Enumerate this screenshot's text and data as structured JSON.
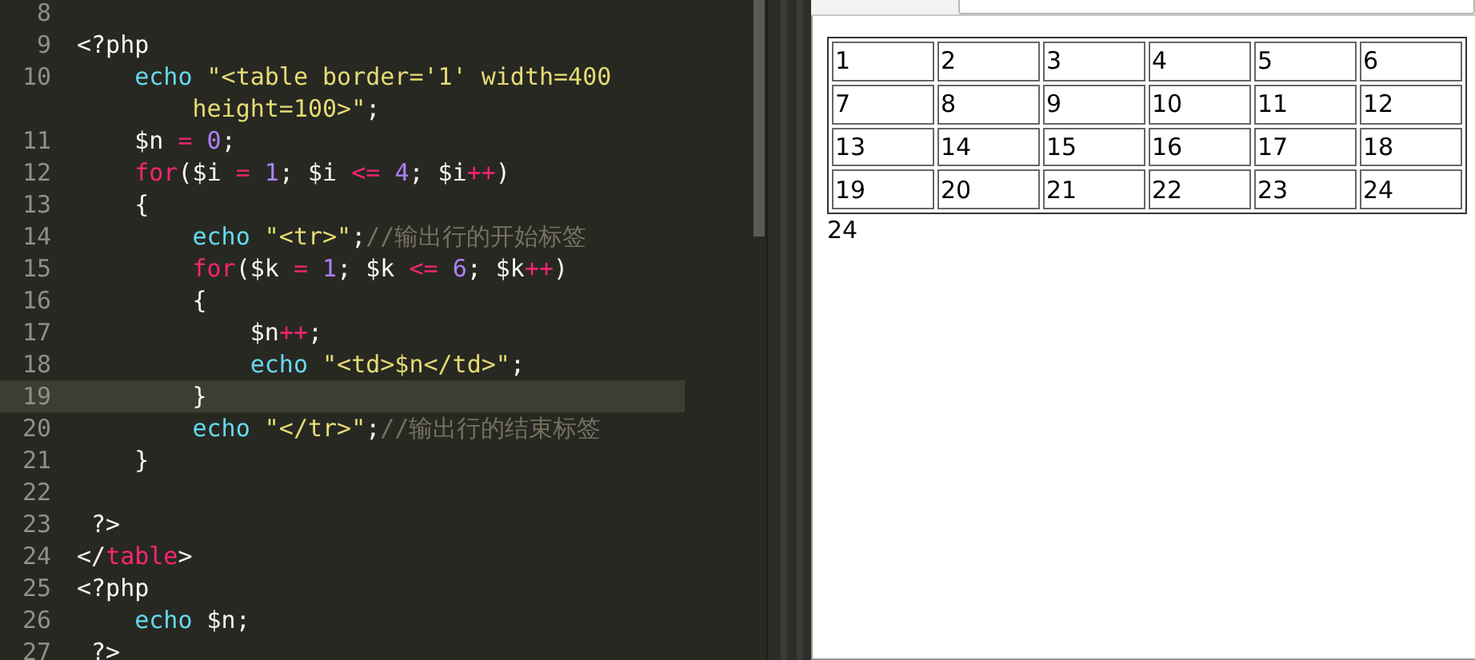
{
  "editor": {
    "lines": [
      {
        "kind": "code",
        "number": "8",
        "current": false
      },
      {
        "kind": "code",
        "number": "9",
        "current": false,
        "tokens": [
          {
            "kind": "plain",
            "text": "<?php"
          }
        ]
      },
      {
        "kind": "code",
        "number": "10",
        "current": false,
        "tokens": [
          {
            "kind": "builtin",
            "text": "    echo "
          },
          {
            "kind": "string",
            "text": "\"<table border='1' width=400"
          }
        ]
      },
      {
        "kind": "continuation",
        "current": false,
        "tokens": [
          {
            "kind": "string",
            "text": "        height=100>\""
          },
          {
            "kind": "plain",
            "text": ";"
          }
        ]
      },
      {
        "kind": "code",
        "number": "11",
        "current": false,
        "tokens": [
          {
            "kind": "plain",
            "text": "    $n "
          },
          {
            "kind": "operator",
            "text": "= "
          },
          {
            "kind": "number",
            "text": "0"
          },
          {
            "kind": "plain",
            "text": ";"
          }
        ]
      },
      {
        "kind": "code",
        "number": "12",
        "current": false,
        "tokens": [
          {
            "kind": "keyword",
            "text": "    for"
          },
          {
            "kind": "plain",
            "text": "($i "
          },
          {
            "kind": "operator",
            "text": "= "
          },
          {
            "kind": "number",
            "text": "1"
          },
          {
            "kind": "plain",
            "text": "; $i "
          },
          {
            "kind": "operator",
            "text": "<= "
          },
          {
            "kind": "number",
            "text": "4"
          },
          {
            "kind": "plain",
            "text": "; $i"
          },
          {
            "kind": "operator",
            "text": "++"
          },
          {
            "kind": "plain",
            "text": ")"
          }
        ]
      },
      {
        "kind": "code",
        "number": "13",
        "current": false,
        "tokens": [
          {
            "kind": "plain",
            "text": "    {"
          }
        ]
      },
      {
        "kind": "code",
        "number": "14",
        "current": false,
        "tokens": [
          {
            "kind": "builtin",
            "text": "        echo "
          },
          {
            "kind": "string",
            "text": "\"<tr>\""
          },
          {
            "kind": "plain",
            "text": ";"
          },
          {
            "kind": "comment",
            "text": "//输出行的开始标签"
          }
        ]
      },
      {
        "kind": "code",
        "number": "15",
        "current": false,
        "tokens": [
          {
            "kind": "keyword",
            "text": "        for"
          },
          {
            "kind": "plain",
            "text": "($k "
          },
          {
            "kind": "operator",
            "text": "= "
          },
          {
            "kind": "number",
            "text": "1"
          },
          {
            "kind": "plain",
            "text": "; $k "
          },
          {
            "kind": "operator",
            "text": "<= "
          },
          {
            "kind": "number",
            "text": "6"
          },
          {
            "kind": "plain",
            "text": "; $k"
          },
          {
            "kind": "operator",
            "text": "++"
          },
          {
            "kind": "plain",
            "text": ")"
          }
        ]
      },
      {
        "kind": "code",
        "number": "16",
        "current": false,
        "tokens": [
          {
            "kind": "plain",
            "text": "        {"
          }
        ]
      },
      {
        "kind": "code",
        "number": "17",
        "current": false,
        "tokens": [
          {
            "kind": "plain",
            "text": "            $n"
          },
          {
            "kind": "operator",
            "text": "++"
          },
          {
            "kind": "plain",
            "text": ";"
          }
        ]
      },
      {
        "kind": "code",
        "number": "18",
        "current": false,
        "tokens": [
          {
            "kind": "builtin",
            "text": "            echo "
          },
          {
            "kind": "string",
            "text": "\"<td>$n</td>\""
          },
          {
            "kind": "plain",
            "text": ";"
          }
        ]
      },
      {
        "kind": "code",
        "number": "19",
        "current": true,
        "tokens": [
          {
            "kind": "plain",
            "text": "        }"
          }
        ]
      },
      {
        "kind": "code",
        "number": "20",
        "current": false,
        "tokens": [
          {
            "kind": "builtin",
            "text": "        echo "
          },
          {
            "kind": "string",
            "text": "\"</tr>\""
          },
          {
            "kind": "plain",
            "text": ";"
          },
          {
            "kind": "comment",
            "text": "//输出行的结束标签"
          }
        ]
      },
      {
        "kind": "code",
        "number": "21",
        "current": false,
        "tokens": [
          {
            "kind": "plain",
            "text": "    }"
          }
        ]
      },
      {
        "kind": "code",
        "number": "22",
        "current": false
      },
      {
        "kind": "code",
        "number": "23",
        "current": false,
        "tokens": [
          {
            "kind": "plain",
            "text": " ?>"
          }
        ]
      },
      {
        "kind": "code",
        "number": "24",
        "current": false,
        "tokens": [
          {
            "kind": "plain",
            "text": "</"
          },
          {
            "kind": "keyword",
            "text": "table"
          },
          {
            "kind": "plain",
            "text": ">"
          }
        ]
      },
      {
        "kind": "code",
        "number": "25",
        "current": false,
        "tokens": [
          {
            "kind": "plain",
            "text": "<?php"
          }
        ]
      },
      {
        "kind": "code",
        "number": "26",
        "current": false,
        "tokens": [
          {
            "kind": "builtin",
            "text": "    echo "
          },
          {
            "kind": "plain",
            "text": "$n;"
          }
        ]
      },
      {
        "kind": "code",
        "number": "27",
        "current": false,
        "tokens": [
          {
            "kind": "plain",
            "text": " ?>"
          }
        ]
      }
    ]
  },
  "browser": {
    "table": {
      "rows": [
        [
          "1",
          "2",
          "3",
          "4",
          "5",
          "6"
        ],
        [
          "7",
          "8",
          "9",
          "10",
          "11",
          "12"
        ],
        [
          "13",
          "14",
          "15",
          "16",
          "17",
          "18"
        ],
        [
          "19",
          "20",
          "21",
          "22",
          "23",
          "24"
        ]
      ]
    },
    "output": "24"
  }
}
